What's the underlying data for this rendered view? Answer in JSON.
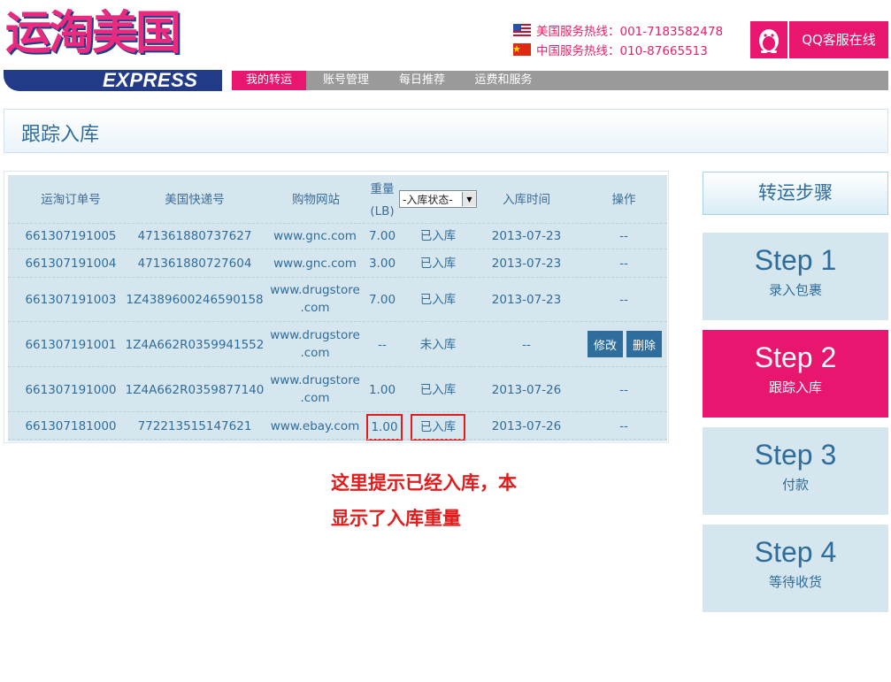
{
  "header": {
    "logo_cn": "运淘美国",
    "logo_en": "EXPRESS",
    "hotline_us": "美国服务热线：001-7183582478",
    "hotline_cn": "中国服务热线：010-87665513",
    "qq_service": "QQ客服在线",
    "nav": [
      "我的转运",
      "账号管理",
      "每日推荐",
      "运费和服务"
    ]
  },
  "page_title": "跟踪入库",
  "table": {
    "headers": {
      "order_no": "运淘订单号",
      "tracking_no": "美国快递号",
      "site": "购物网站",
      "weight_line1": "重量",
      "weight_line2": "(LB)",
      "status_select": "-入库状态-",
      "time": "入库时间",
      "action": "操作"
    },
    "rows": [
      {
        "order": "661307191005",
        "tracking": "471361880737627",
        "site_a": "www.gnc.com",
        "site_b": "",
        "weight": "7.00",
        "status": "已入库",
        "time": "2013-07-23",
        "action": "--"
      },
      {
        "order": "661307191004",
        "tracking": "471361880727604",
        "site_a": "www.gnc.com",
        "site_b": "",
        "weight": "3.00",
        "status": "已入库",
        "time": "2013-07-23",
        "action": "--"
      },
      {
        "order": "661307191003",
        "tracking": "1Z4389600246590158",
        "site_a": "www.drugstore",
        "site_b": ".com",
        "weight": "7.00",
        "status": "已入库",
        "time": "2013-07-23",
        "action": "--"
      },
      {
        "order": "661307191001",
        "tracking": "1Z4A662R0359941552",
        "site_a": "www.drugstore",
        "site_b": ".com",
        "weight": "--",
        "status": "未入库",
        "time": "--",
        "action": ""
      },
      {
        "order": "661307191000",
        "tracking": "1Z4A662R0359877140",
        "site_a": "www.drugstore",
        "site_b": ".com",
        "weight": "1.00",
        "status": "已入库",
        "time": "2013-07-26",
        "action": "--"
      },
      {
        "order": "661307181000",
        "tracking": "772213515147621",
        "site_a": "www.ebay.com",
        "site_b": "",
        "weight": "1.00",
        "status": "已入库",
        "time": "2013-07-26",
        "action": "--"
      }
    ],
    "edit_label": "修改",
    "delete_label": "删除"
  },
  "note": {
    "line1": "这里提示已经入库，本",
    "line2": "显示了入库重量"
  },
  "steps": {
    "title": "转运步骤",
    "items": [
      {
        "num": "Step 1",
        "desc": "录入包裹"
      },
      {
        "num": "Step 2",
        "desc": "跟踪入库"
      },
      {
        "num": "Step 3",
        "desc": "付款"
      },
      {
        "num": "Step 4",
        "desc": "等待收货"
      }
    ]
  },
  "colors": {
    "brand_pink": "#e8166e",
    "brand_blue": "#2e6d9c",
    "table_bg": "#d6e6ef",
    "highlight_red": "#e21c1c"
  }
}
